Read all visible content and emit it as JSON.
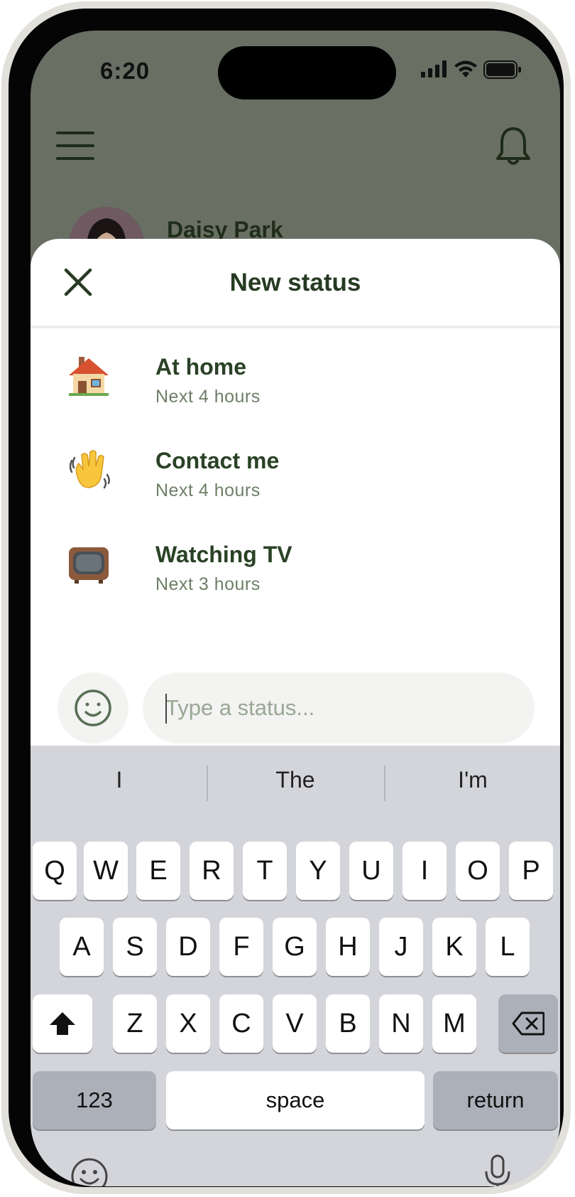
{
  "status_bar": {
    "time": "6:20"
  },
  "profile": {
    "name": "Daisy Park"
  },
  "sheet": {
    "title": "New status"
  },
  "statuses": [
    {
      "emoji": "house-emoji",
      "title": "At home",
      "duration": "Next 4 hours"
    },
    {
      "emoji": "waving-hand-emoji",
      "title": "Contact me",
      "duration": "Next 4 hours"
    },
    {
      "emoji": "television-emoji",
      "title": "Watching TV",
      "duration": "Next 3 hours"
    }
  ],
  "input": {
    "placeholder": "Type a status..."
  },
  "keyboard": {
    "suggestions": [
      "I",
      "The",
      "I'm"
    ],
    "row1": [
      "Q",
      "W",
      "E",
      "R",
      "T",
      "Y",
      "U",
      "I",
      "O",
      "P"
    ],
    "row2": [
      "A",
      "S",
      "D",
      "F",
      "G",
      "H",
      "J",
      "K",
      "L"
    ],
    "row3": [
      "Z",
      "X",
      "C",
      "V",
      "B",
      "N",
      "M"
    ],
    "numbers_label": "123",
    "space_label": "space",
    "return_label": "return"
  },
  "colors": {
    "accent_dark_green": "#263b22",
    "subtitle_green": "#6d7f66",
    "overlay_background": "#6a6f64",
    "keyboard_background": "#d4d5da"
  }
}
